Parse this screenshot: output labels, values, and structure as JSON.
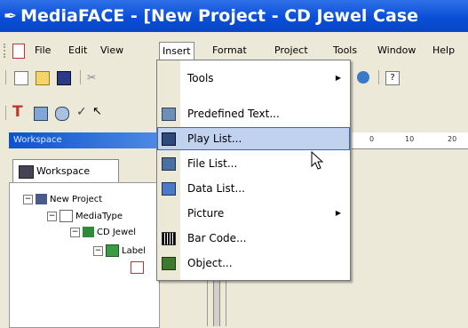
{
  "titlebar": {
    "app_icon": "mediaface-icon",
    "title": "MediaFACE - [New Project - CD Jewel Case"
  },
  "menubar": {
    "items": [
      {
        "label": "File"
      },
      {
        "label": "Edit"
      },
      {
        "label": "View"
      },
      {
        "label": "Insert"
      },
      {
        "label": "Format"
      },
      {
        "label": "Project"
      },
      {
        "label": "Tools"
      },
      {
        "label": "Window"
      },
      {
        "label": "Help"
      }
    ]
  },
  "workspace": {
    "header": "Workspace",
    "tab_label": "Workspace",
    "tree": [
      {
        "label": "New Project"
      },
      {
        "label": "MediaType"
      },
      {
        "label": "CD Jewel"
      },
      {
        "label": "Label"
      }
    ]
  },
  "ruler": {
    "ticks": [
      "0",
      "10",
      "20"
    ]
  },
  "insert_menu": {
    "items": [
      {
        "label": "Tools",
        "icon": "none",
        "submenu": true
      },
      {
        "label": "Predefined Text...",
        "icon": "text-icon",
        "submenu": false
      },
      {
        "label": "Play List...",
        "icon": "playlist-icon",
        "submenu": false
      },
      {
        "label": "File List...",
        "icon": "filelist-icon",
        "submenu": false
      },
      {
        "label": "Data List...",
        "icon": "datalist-icon",
        "submenu": false
      },
      {
        "label": "Picture",
        "icon": "none",
        "submenu": true
      },
      {
        "label": "Bar Code...",
        "icon": "barcode-icon",
        "submenu": false
      },
      {
        "label": "Object...",
        "icon": "object-icon",
        "submenu": false
      }
    ]
  },
  "colors": {
    "titlebar": "#0a4fd8",
    "highlight": "#c1d2ee",
    "highlight_border": "#316ac5"
  }
}
